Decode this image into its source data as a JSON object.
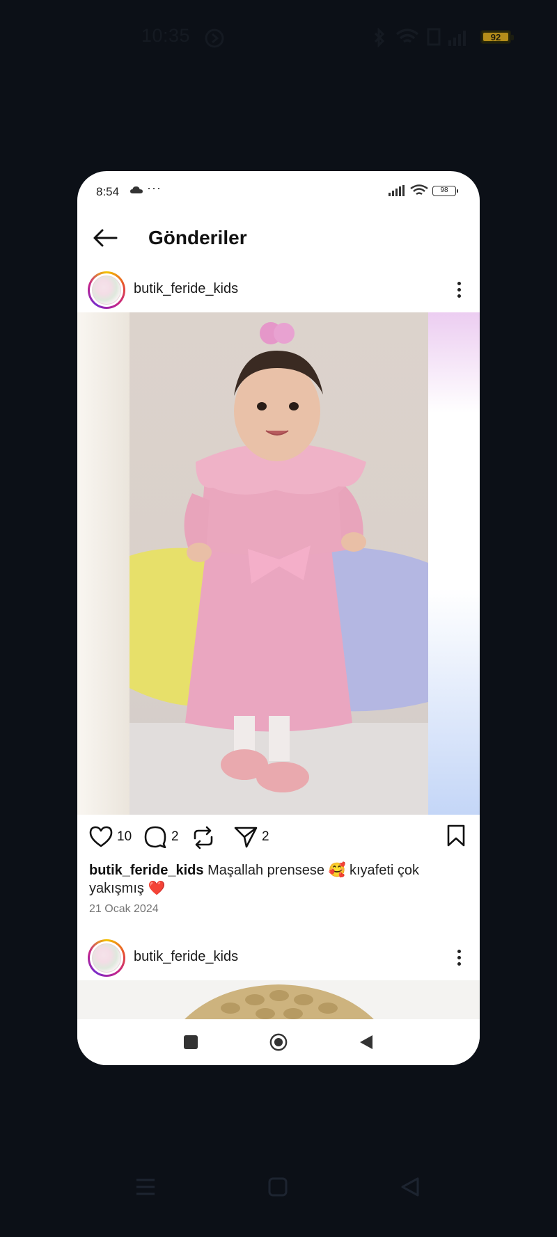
{
  "device": {
    "time": "10:35",
    "battery": "92"
  },
  "phone_status": {
    "time": "8:54",
    "dots": "···",
    "battery": "98"
  },
  "header": {
    "title": "Gönderiler"
  },
  "post1": {
    "username": "butik_feride_kids",
    "likes": "10",
    "comments": "2",
    "shares": "2",
    "caption_user": "butik_feride_kids",
    "caption_text": " Maşallah prensese 🥰 kıyafeti çok yakışmış ❤️",
    "date": "21 Ocak 2024"
  },
  "post2": {
    "username": "butik_feride_kids"
  },
  "icons": {
    "back": "arrow-left",
    "more": "vertical-dots",
    "like": "heart-outline",
    "comment": "speech-bubble",
    "repost": "repeat-arrows",
    "send": "paper-plane",
    "save": "bookmark-outline"
  },
  "colors": {
    "background": "#0c1017",
    "accent_battery": "#b48d1a",
    "avatar_ring": "#c3238c"
  }
}
